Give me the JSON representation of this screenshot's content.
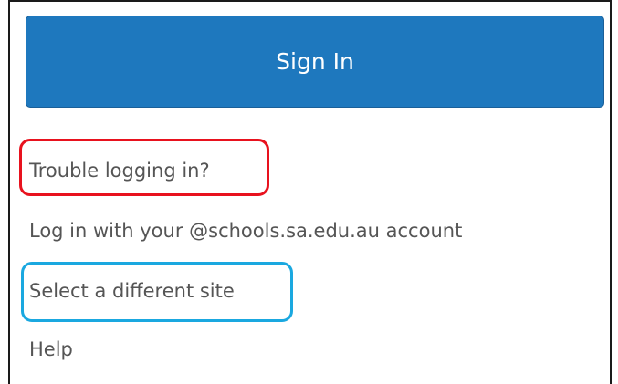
{
  "signin": {
    "label": "Sign In",
    "color": "#1e78be"
  },
  "links": {
    "trouble": "Trouble logging in?",
    "schools": "Log in with your @schools.sa.edu.au account",
    "site": "Select a different site",
    "help": "Help"
  },
  "highlights": {
    "red_color": "#e8121e",
    "blue_color": "#1aa8e0"
  }
}
